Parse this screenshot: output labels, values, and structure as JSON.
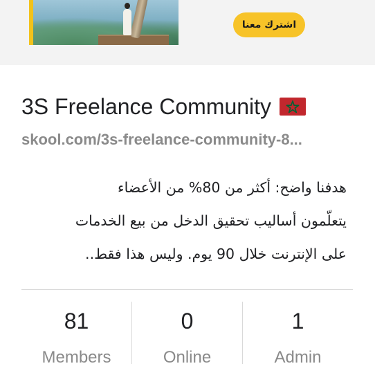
{
  "banner": {
    "join_label": "اشترك معنا"
  },
  "group": {
    "title": "3S Freelance Community",
    "flag_icon": "morocco-flag-icon",
    "url": "skool.com/3s-freelance-community-8...",
    "description_lines": [
      "هدفنا واضح: أكثر من 80% من الأعضاء",
      "يتعلّمون أساليب تحقيق الدخل من بيع الخدمات",
      "على الإنترنت خلال 90 يوم. وليس هذا فقط.."
    ]
  },
  "stats": [
    {
      "value": "81",
      "label": "Members"
    },
    {
      "value": "0",
      "label": "Online"
    },
    {
      "value": "1",
      "label": "Admin"
    }
  ],
  "colors": {
    "accent_yellow": "#f7c328",
    "muted_text": "#8a8a8a",
    "flag_red": "#c1272d",
    "flag_green": "#006233"
  }
}
